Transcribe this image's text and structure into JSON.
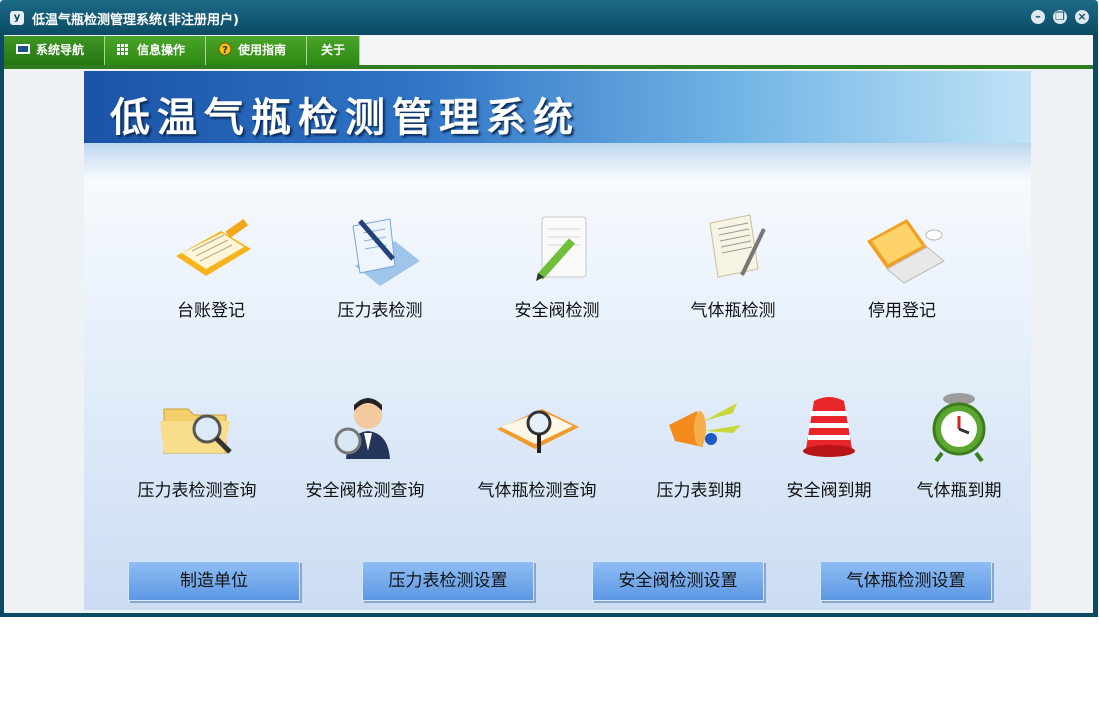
{
  "window": {
    "title": "低温气瓶检测管理系统(非注册用户)",
    "app_icon_letter": "y"
  },
  "menu": [
    {
      "label": "系统导航"
    },
    {
      "label": "信息操作"
    },
    {
      "label": "使用指南"
    },
    {
      "label": "关于"
    }
  ],
  "banner": {
    "title": "低温气瓶检测管理系统"
  },
  "tiles_row1": [
    {
      "label": "台账登记",
      "icon": "ledger-icon"
    },
    {
      "label": "压力表检测",
      "icon": "document-pen-icon"
    },
    {
      "label": "安全阀检测",
      "icon": "notepad-pencil-icon"
    },
    {
      "label": "气体瓶检测",
      "icon": "paper-pen-icon"
    },
    {
      "label": "停用登记",
      "icon": "laptop-icon"
    }
  ],
  "tiles_row2": [
    {
      "label": "压力表检测查询",
      "icon": "folder-search-icon"
    },
    {
      "label": "安全阀检测查询",
      "icon": "person-search-icon"
    },
    {
      "label": "气体瓶检测查询",
      "icon": "book-search-icon"
    },
    {
      "label": "压力表到期",
      "icon": "megaphone-icon"
    },
    {
      "label": "安全阀到期",
      "icon": "alarm-bell-icon"
    },
    {
      "label": "气体瓶到期",
      "icon": "alarm-clock-icon"
    }
  ],
  "buttons": [
    {
      "label": "制造单位"
    },
    {
      "label": "压力表检测设置"
    },
    {
      "label": "安全阀检测设置"
    },
    {
      "label": "气体瓶检测设置"
    }
  ]
}
